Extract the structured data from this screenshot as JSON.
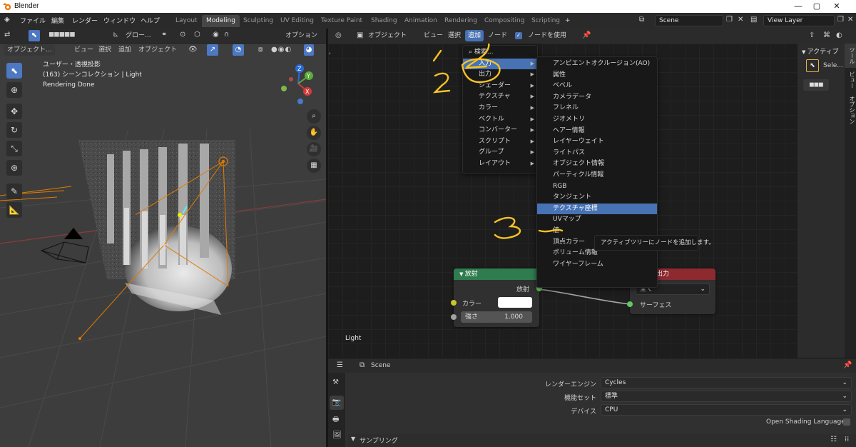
{
  "window": {
    "title": "Blender",
    "minimize": "—",
    "maximize": "▢",
    "close": "✕"
  },
  "menubar": {
    "items": [
      "ファイル",
      "編集",
      "レンダー",
      "ウィンドウ",
      "ヘルプ"
    ]
  },
  "workspaces": {
    "tabs": [
      "Layout",
      "Modeling",
      "Sculpting",
      "UV Editing",
      "Texture Paint",
      "Shading",
      "Animation",
      "Rendering",
      "Compositing",
      "Scripting"
    ],
    "active": "Modeling",
    "add": "+"
  },
  "scene": {
    "name": "Scene",
    "view_layer": "View Layer"
  },
  "viewport_header": {
    "transform": "グロー...",
    "options": "オプション"
  },
  "viewport_menu": {
    "mode": "オブジェクト...",
    "items": [
      "ビュー",
      "選択",
      "追加",
      "オブジェクト"
    ]
  },
  "viewport_info": {
    "line1": "ユーザー・透視投影",
    "line2": "(163) シーンコレクション | Light",
    "line3": "Rendering Done"
  },
  "gizmo": {
    "z": "Z",
    "y": "Y",
    "x": "X"
  },
  "node_header": {
    "mode": "オブジェクト",
    "items": [
      "ビュー",
      "選択",
      "追加",
      "ノード"
    ],
    "use_nodes": "ノードを使用",
    "active_item": "追加"
  },
  "add_menu": {
    "search": "検索...",
    "items": [
      "入力",
      "出力",
      "シェーダー",
      "テクスチャ",
      "カラー",
      "ベクトル",
      "コンバーター",
      "スクリプト",
      "グループ",
      "レイアウト"
    ],
    "highlighted": "入力"
  },
  "input_submenu": {
    "items": [
      "アンビエントオクルージョン(AO)",
      "属性",
      "ベベル",
      "カメラデータ",
      "フレネル",
      "ジオメトリ",
      "ヘアー情報",
      "レイヤーウェイト",
      "ライトパス",
      "オブジェクト情報",
      "パーティクル情報",
      "RGB",
      "タンジェント",
      "テクスチャ座標",
      "UVマップ",
      "値",
      "頂点カラー",
      "ボリューム情報",
      "ワイヤーフレーム"
    ],
    "highlighted": "テクスチャ座標"
  },
  "tooltip": {
    "text": "アクティブツリーにノードを追加します。"
  },
  "emission_node": {
    "title": "放射",
    "output": "放射",
    "color_label": "カラー",
    "strength_label": "強さ",
    "strength_value": "1.000",
    "color": "#2f7d4f"
  },
  "output_node": {
    "title": "ー出力",
    "target": "全て",
    "surface": "サーフェス",
    "color": "#8c2a2f"
  },
  "node_editor_label": "Light",
  "sidebar": {
    "header": "アクティブ",
    "select": "Sele...",
    "tabs": [
      "ツール",
      "ビュー",
      "オプション"
    ]
  },
  "properties": {
    "context": "Scene",
    "render_engine_label": "レンダーエンジン",
    "render_engine": "Cycles",
    "feature_set_label": "機能セット",
    "feature_set": "標準",
    "device_label": "デバイス",
    "device": "CPU",
    "osl": "Open Shading Language",
    "section": "サンプリング"
  },
  "annotations": {
    "one": "1",
    "two_a": "2",
    "two_b": "2",
    "three": "3"
  },
  "colors": {
    "accent": "#4772b3",
    "annotation": "#f7c324"
  }
}
